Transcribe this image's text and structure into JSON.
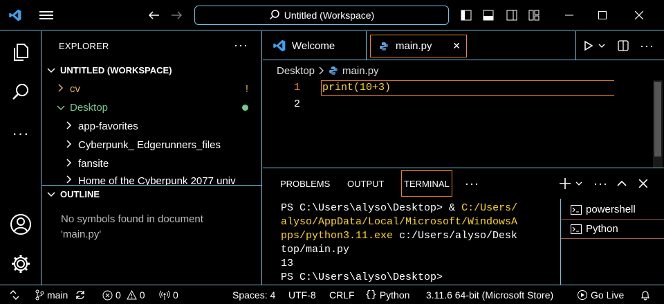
{
  "titlebar": {
    "search_text": "Untitled (Workspace)",
    "icons": [
      "vscode-logo-icon",
      "menu-icon",
      "back-arrow-icon",
      "forward-arrow-icon",
      "search-icon",
      "toggle-primary-sidebar-icon",
      "toggle-panel-icon",
      "toggle-secondary-sidebar-icon",
      "customize-layout-icon",
      "minimize-icon",
      "maximize-icon",
      "close-icon"
    ]
  },
  "activity": {
    "icons": [
      "explorer-icon",
      "search-icon",
      "more-icon",
      "accounts-icon",
      "settings-gear-icon"
    ]
  },
  "sidebar": {
    "title": "EXPLORER",
    "more": "···",
    "workspace": "UNTITLED (WORKSPACE)",
    "tree": [
      {
        "label": "cv",
        "chevron": "›",
        "color": "#e0b050",
        "badge": "!"
      },
      {
        "label": "Desktop",
        "chevron": "⌄",
        "color": "#73c991",
        "badge": "●"
      },
      {
        "label": "app-favorites",
        "chevron": "›"
      },
      {
        "label": "Cyberpunk_ Edgerunners_files",
        "chevron": "›"
      },
      {
        "label": "fansite",
        "chevron": "›"
      },
      {
        "label": "Home of the Cyberpunk 2077 univ",
        "chevron": "›"
      }
    ],
    "outline": {
      "title": "OUTLINE",
      "empty": "No symbols found in document 'main.py'"
    }
  },
  "editor": {
    "tabs": [
      {
        "label": "Welcome",
        "active": false
      },
      {
        "label": "main.py",
        "active": true,
        "close": "✕"
      }
    ],
    "breadcrumb": [
      "Desktop",
      "main.py"
    ],
    "lines": [
      {
        "num": "1",
        "code": "print(10+3)"
      },
      {
        "num": "2",
        "code": ""
      }
    ]
  },
  "panel": {
    "tabs": [
      "PROBLEMS",
      "OUTPUT",
      "TERMINAL"
    ],
    "active_tab": "TERMINAL",
    "more": "···",
    "terminal": {
      "prompt1": "PS C:\\Users\\alyso\\Desktop> ",
      "cmd_amp": "& ",
      "cmd_path": "C:/Users/\nalyso/AppData/Local/Microsoft/WindowsA\npps/python3.11.exe",
      "cmd_arg": " c:/Users/alyso/Desk\ntop/main.py",
      "output": "13",
      "prompt2": "PS C:\\Users\\alyso\\Desktop>"
    },
    "terminals": [
      "powershell",
      "Python"
    ]
  },
  "status": {
    "branch": "main",
    "errors": "0",
    "warnings": "0",
    "ports": "0",
    "spaces": "Spaces: 4",
    "encoding": "UTF-8",
    "eol": "CRLF",
    "language": "Python",
    "interpreter": "3.11.6 64-bit (Microsoft Store)",
    "golive": "Go Live"
  },
  "colors": {
    "border": "#6fc3df",
    "active_border": "#f38518",
    "accent_orange": "#f38518",
    "terminal_yellow": "#ffd700"
  }
}
